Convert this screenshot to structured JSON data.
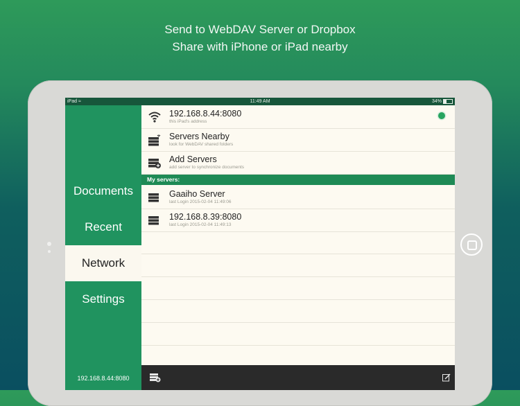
{
  "promo": {
    "line1": "Send to WebDAV Server or Dropbox",
    "line2": "Share with iPhone or iPad nearby"
  },
  "status_bar": {
    "device": "iPad",
    "time": "11:49 AM",
    "battery": "34%"
  },
  "sidebar": {
    "items": [
      {
        "label": "Documents"
      },
      {
        "label": "Recent"
      },
      {
        "label": "Network"
      },
      {
        "label": "Settings"
      }
    ],
    "active": "Network",
    "footer_ip": "192.168.8.44:8080"
  },
  "network": {
    "address": {
      "title": "192.168.8.44:8080",
      "subtitle": "this iPad's address",
      "icon": "wifi-icon",
      "status_color": "#27a45f"
    },
    "nearby": {
      "title": "Servers Nearby",
      "subtitle": "look for WebDAV shared folders",
      "icon": "server-wifi-icon"
    },
    "add": {
      "title": "Add Servers",
      "subtitle": "add server to synchronize documents",
      "icon": "server-add-icon"
    }
  },
  "my_servers": {
    "header": "My servers:",
    "items": [
      {
        "title": "Gaaiho Server",
        "subtitle": "last Login 2015-02-04 11:49:06",
        "icon": "server-icon"
      },
      {
        "title": "192.168.8.39:8080",
        "subtitle": "last Login 2015-02-04 11:49:13",
        "icon": "server-icon"
      }
    ]
  },
  "bottom_bar": {
    "left_icon": "server-add-icon",
    "right_icon": "edit-icon"
  },
  "colors": {
    "accent": "#20935f",
    "section": "#1e8a55",
    "status_bar": "#17563b",
    "bottom_bar": "#2a2a2a"
  }
}
